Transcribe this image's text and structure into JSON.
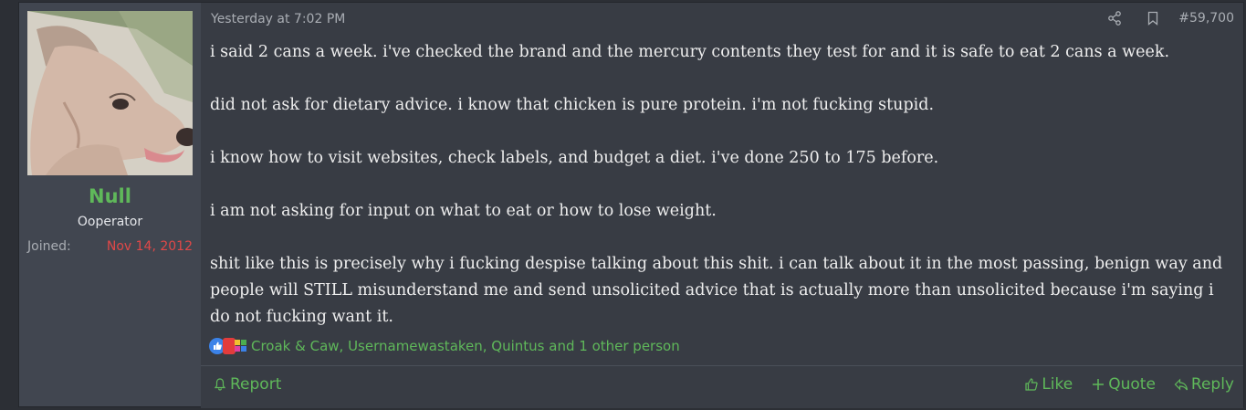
{
  "user": {
    "name": "Null",
    "title": "Ooperator",
    "joined_label": "Joined:",
    "joined_date": "Nov 14, 2012",
    "avatar_icon": "dog-avatar"
  },
  "post": {
    "timestamp": "Yesterday at 7:02 PM",
    "number": "#59,700",
    "paragraphs": [
      "i said 2 cans a week. i've checked the brand and the mercury contents they test for and it is safe to eat 2 cans a week.",
      "did not ask for dietary advice. i know that chicken is pure protein. i'm not fucking stupid.",
      "i know how to visit websites, check labels, and budget a diet. i've done 250 to 175 before.",
      "i am not asking for input on what to eat or how to lose weight.",
      "shit like this is precisely why i fucking despise talking about this shit. i can talk about it in the most passing, benign way and people will STILL misunderstand me and send unsolicited advice that is actually more than unsolicited because i'm saying i do not fucking want it."
    ],
    "reactions_text": "Croak & Caw, Usernamewastaken, Quintus and 1 other person"
  },
  "footer": {
    "report": "Report",
    "like": "Like",
    "quote": "Quote",
    "reply": "Reply"
  },
  "colors": {
    "accent_green": "#5fb85a",
    "date_red": "#e04848",
    "background": "#383c44",
    "sidebar": "#414650"
  }
}
